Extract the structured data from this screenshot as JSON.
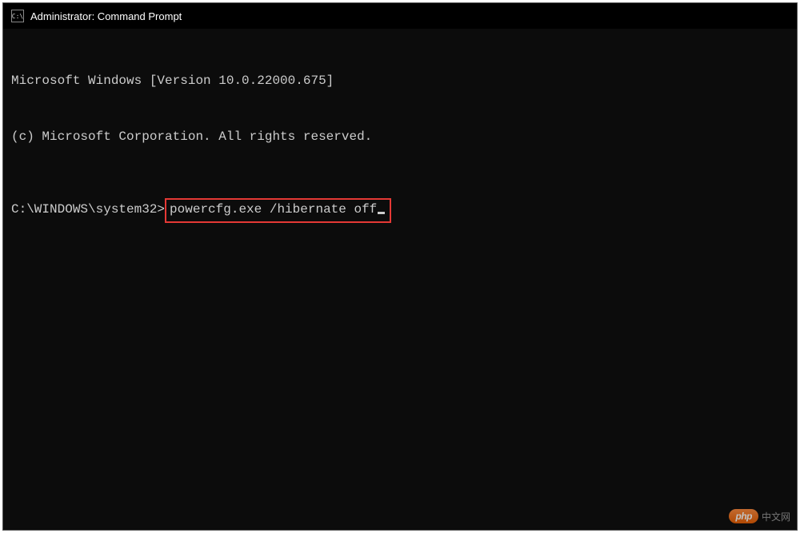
{
  "window": {
    "title": "Administrator: Command Prompt",
    "icon_label": "C:\\"
  },
  "terminal": {
    "line1": "Microsoft Windows [Version 10.0.22000.675]",
    "line2": "(c) Microsoft Corporation. All rights reserved.",
    "prompt": "C:\\WINDOWS\\system32>",
    "command": "powercfg.exe /hibernate off"
  },
  "watermark": {
    "badge": "php",
    "text": "中文网"
  }
}
